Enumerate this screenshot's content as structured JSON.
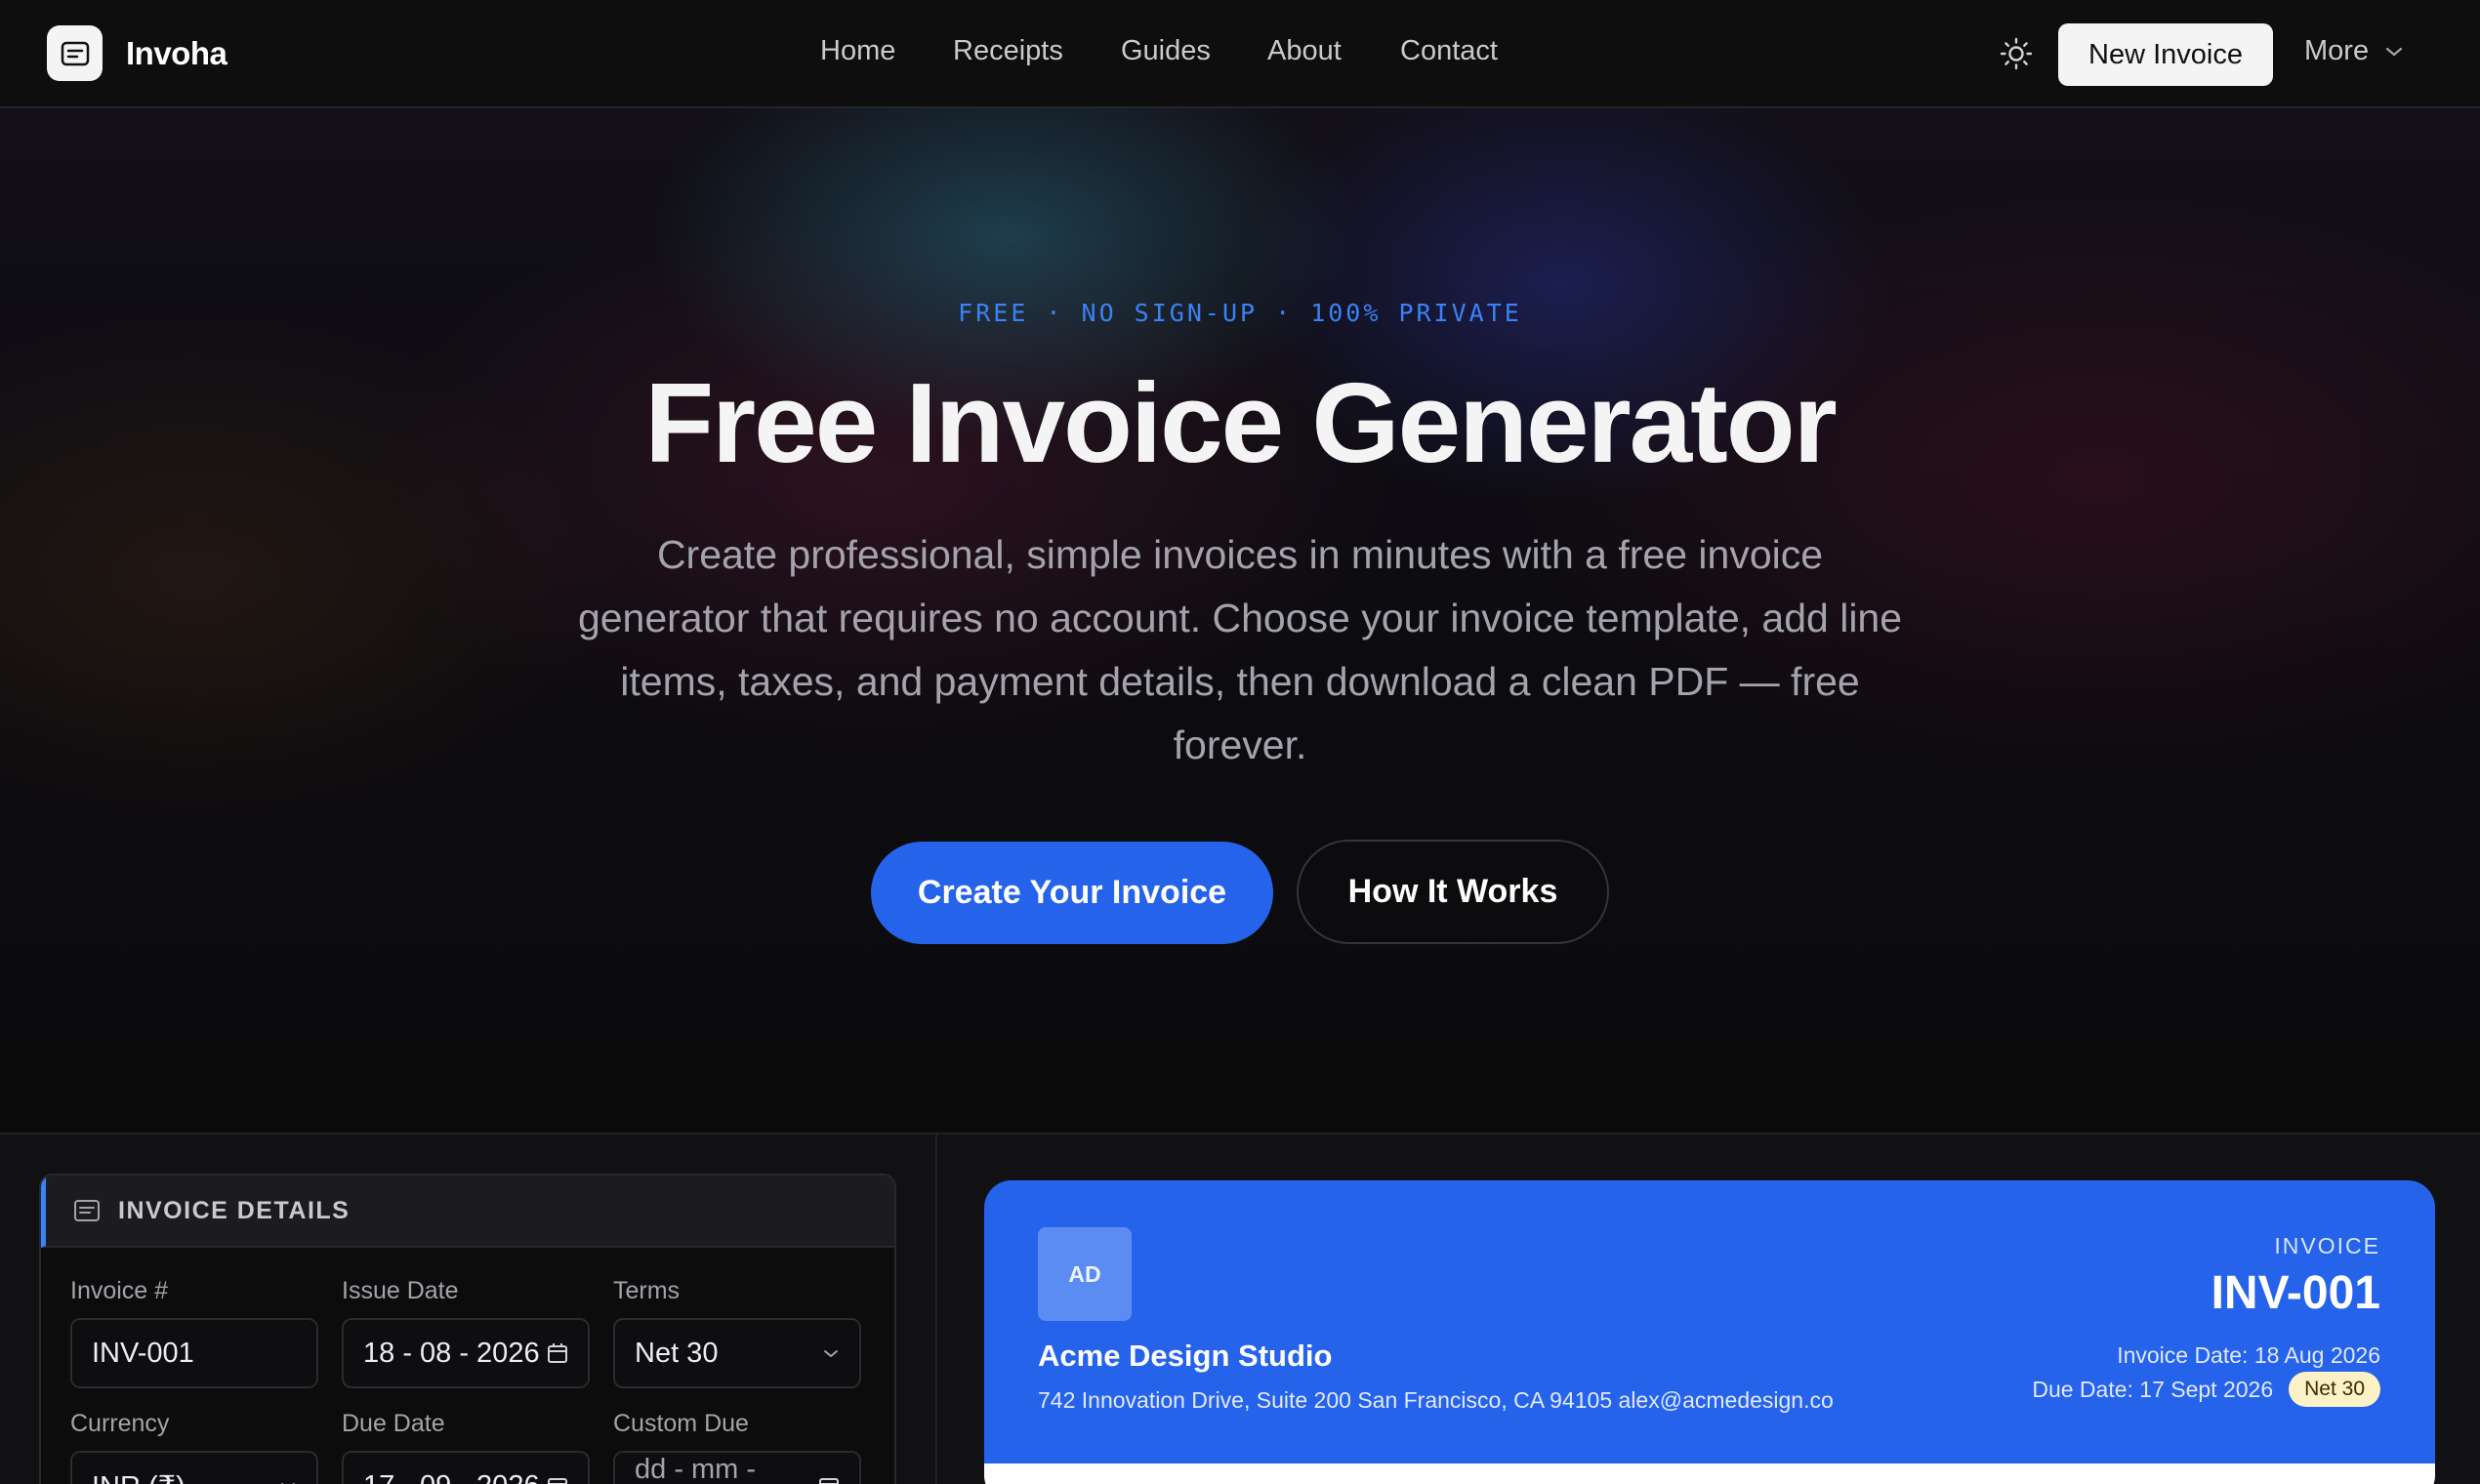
{
  "nav": {
    "brand": "Invoha",
    "links": [
      "Home",
      "Receipts",
      "Guides",
      "About",
      "Contact"
    ],
    "new_invoice": "New Invoice",
    "more": "More",
    "theme_icon": "sun-icon"
  },
  "hero": {
    "eyebrow": "FREE · NO SIGN-UP · 100% PRIVATE",
    "title": "Free Invoice Generator",
    "subtitle": "Create professional, simple invoices in minutes with a free invoice generator that requires no account. Choose your invoice template, add line items, taxes, and payment details, then download a clean PDF — free forever.",
    "cta_primary": "Create Your Invoice",
    "cta_secondary": "How It Works"
  },
  "colors": {
    "accent": "#2563eb",
    "eyebrow": "#3b82f6",
    "background": "#0b0b0c",
    "badge": "#fdf2c5"
  },
  "editor": {
    "section_title": "INVOICE DETAILS",
    "fields": {
      "invoice_number": {
        "label": "Invoice #",
        "value": "INV-001"
      },
      "issue_date": {
        "label": "Issue Date",
        "value": "18 - 08 - 2026"
      },
      "terms": {
        "label": "Terms",
        "value": "Net 30"
      },
      "currency": {
        "label": "Currency",
        "value": "INR (₹)"
      },
      "due_date": {
        "label": "Due Date",
        "value": "17 - 09 - 2026"
      },
      "custom_due": {
        "label": "Custom Due",
        "placeholder": "dd - mm - yyyy"
      }
    }
  },
  "preview": {
    "initials": "AD",
    "company": "Acme Design Studio",
    "address": "742 Innovation Drive, Suite 200 San Francisco, CA 94105 alex@acmedesign.co",
    "label": "INVOICE",
    "number": "INV-001",
    "invoice_date": "Invoice Date: 18 Aug 2026",
    "due_date": "Due Date: 17 Sept 2026",
    "terms_badge": "Net 30"
  }
}
